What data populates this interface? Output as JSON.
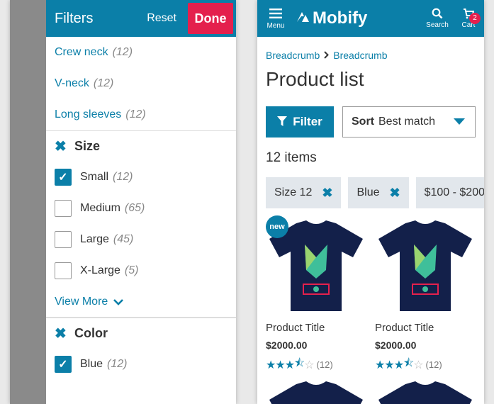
{
  "filter_panel": {
    "title": "Filters",
    "reset": "Reset",
    "done": "Done",
    "links": [
      {
        "label": "Crew neck",
        "count": "(12)"
      },
      {
        "label": "V-neck",
        "count": "(12)"
      },
      {
        "label": "Long sleeves",
        "count": "(12)"
      }
    ],
    "size_section": {
      "title": "Size",
      "options": [
        {
          "label": "Small",
          "count": "(12)",
          "checked": true
        },
        {
          "label": "Medium",
          "count": "(65)",
          "checked": false
        },
        {
          "label": "Large",
          "count": "(45)",
          "checked": false
        },
        {
          "label": "X-Large",
          "count": "(5)",
          "checked": false
        }
      ],
      "view_more": "View More"
    },
    "color_section": {
      "title": "Color",
      "options": [
        {
          "label": "Blue",
          "count": "(12)",
          "checked": true
        }
      ]
    }
  },
  "header": {
    "menu_label": "Menu",
    "logo": "Mobify",
    "search_label": "Search",
    "cart_label": "Cart",
    "cart_count": "2"
  },
  "breadcrumb": [
    "Breadcrumb",
    "Breadcrumb"
  ],
  "page_title": "Product list",
  "toolbar": {
    "filter_label": "Filter",
    "sort_label": "Sort",
    "sort_value": "Best match"
  },
  "items_count": "12 items",
  "chips": [
    "Size 12",
    "Blue",
    "$100 - $200"
  ],
  "products": [
    {
      "badge": "new",
      "title": "Product Title",
      "price": "$2000.00",
      "rating": 3.5,
      "reviews": "(12)"
    },
    {
      "badge": "",
      "title": "Product Title",
      "price": "$2000.00",
      "rating": 3.5,
      "reviews": "(12)"
    }
  ],
  "colors": {
    "brand": "#0b7fa8",
    "accent": "#e4204d",
    "shirt": "#13204a"
  }
}
